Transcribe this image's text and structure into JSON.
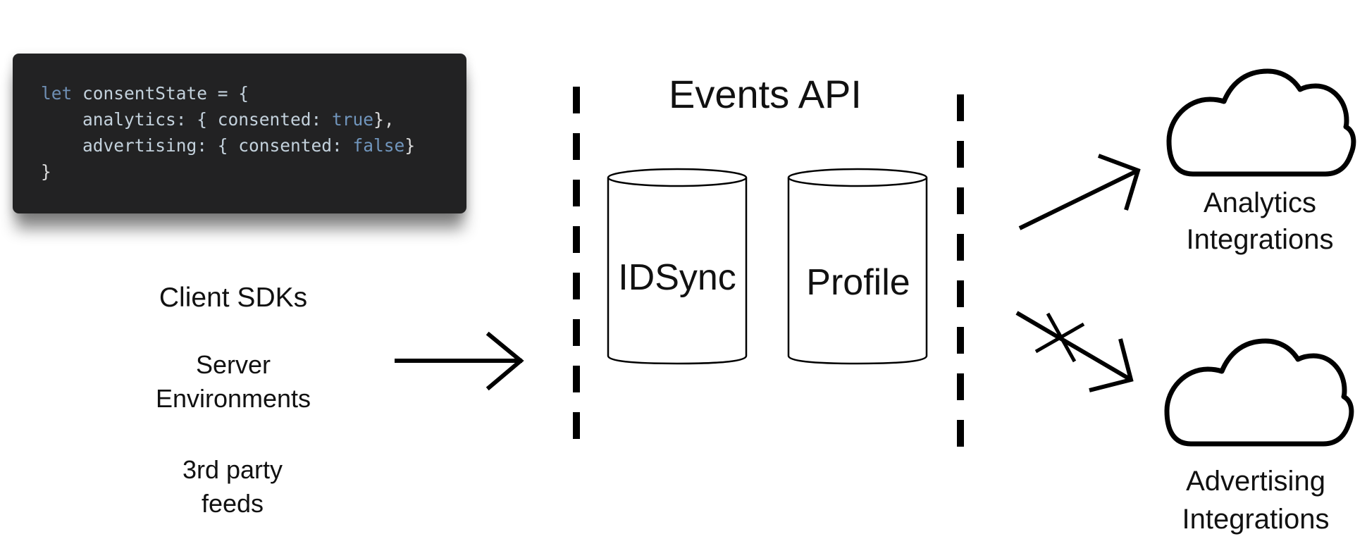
{
  "code_snippet": {
    "lines": [
      {
        "keyword": "let",
        "text": " consentState = {"
      },
      {
        "indent": "    ",
        "key": "analytics",
        "mid": ": { consented: ",
        "value": "true",
        "end": "},"
      },
      {
        "indent": "    ",
        "key": "advertising",
        "mid": ": { consented: ",
        "value": "false",
        "end": "}"
      },
      {
        "text": "}"
      }
    ]
  },
  "sources": {
    "client_sdks": "Client SDKs",
    "server_environments": [
      "Server",
      "Environments"
    ],
    "third_party_feeds": [
      "3rd party",
      "feeds"
    ]
  },
  "events_api": {
    "title": "Events API",
    "stores": [
      {
        "label": "IDSync"
      },
      {
        "label": "Profile"
      }
    ]
  },
  "destinations": {
    "analytics": {
      "line1": "Analytics",
      "line2": "Integrations",
      "consented": true
    },
    "advertising": {
      "line1": "Advertising",
      "line2": "Integrations",
      "consented": false
    }
  },
  "colors": {
    "code_background": "#222223",
    "code_keyword": "#6f8fb4",
    "code_text": "#c3d1dc",
    "code_boolean": "#7196bd",
    "ink": "#000000"
  }
}
